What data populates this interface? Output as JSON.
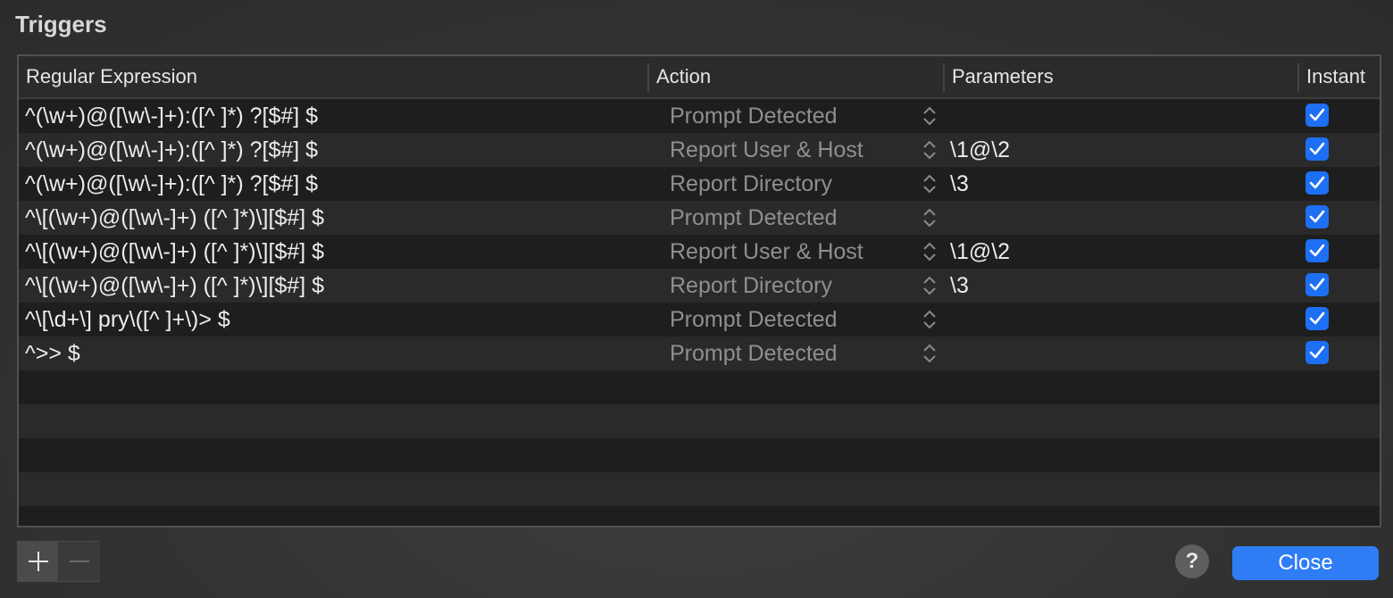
{
  "window": {
    "title": "Triggers"
  },
  "table": {
    "columns": [
      "Regular Expression",
      "Action",
      "Parameters",
      "Instant"
    ],
    "rows": [
      {
        "regex": "^(\\w+)@([\\w\\-]+):([^ ]*) ?[$#] $",
        "action": "Prompt Detected",
        "params": "",
        "instant": true
      },
      {
        "regex": "^(\\w+)@([\\w\\-]+):([^ ]*) ?[$#] $",
        "action": "Report User & Host",
        "params": "\\1@\\2",
        "instant": true
      },
      {
        "regex": "^(\\w+)@([\\w\\-]+):([^ ]*) ?[$#] $",
        "action": "Report Directory",
        "params": "\\3",
        "instant": true
      },
      {
        "regex": "^\\[(\\w+)@([\\w\\-]+) ([^ ]*)\\][$#] $",
        "action": "Prompt Detected",
        "params": "",
        "instant": true
      },
      {
        "regex": "^\\[(\\w+)@([\\w\\-]+) ([^ ]*)\\][$#] $",
        "action": "Report User & Host",
        "params": "\\1@\\2",
        "instant": true
      },
      {
        "regex": "^\\[(\\w+)@([\\w\\-]+) ([^ ]*)\\][$#] $",
        "action": "Report Directory",
        "params": "\\3",
        "instant": true
      },
      {
        "regex": "^\\[\\d+\\] pry\\([^ ]+\\)> $",
        "action": "Prompt Detected",
        "params": "",
        "instant": true
      },
      {
        "regex": "^>> $",
        "action": "Prompt Detected",
        "params": "",
        "instant": true
      }
    ]
  },
  "buttons": {
    "add_icon": "plus-icon",
    "remove_icon": "minus-icon",
    "help_label": "?",
    "close_label": "Close"
  },
  "colors": {
    "accent": "#2f7df5",
    "checkbox": "#1d6ff3"
  }
}
